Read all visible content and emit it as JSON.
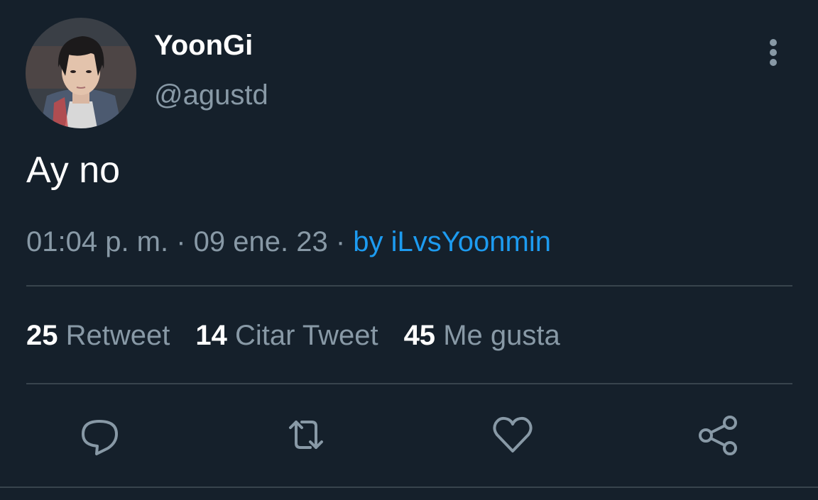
{
  "tweet": {
    "display_name": "YoonGi",
    "handle": "@agustd",
    "text": "Ay no",
    "time": "01:04 p. m.",
    "separator_1": " · ",
    "date": "09 ene. 23",
    "separator_2": " · ",
    "source": "by iLvsYoonmin"
  },
  "stats": [
    {
      "count": "25",
      "label": "Retweet"
    },
    {
      "count": "14",
      "label": "Citar Tweet"
    },
    {
      "count": "45",
      "label": "Me gusta"
    }
  ],
  "actions": [
    {
      "icon": "reply-icon"
    },
    {
      "icon": "retweet-icon"
    },
    {
      "icon": "like-icon"
    },
    {
      "icon": "share-icon"
    }
  ],
  "theme": {
    "background": "#15202b",
    "primary_text": "#ffffff",
    "secondary_text": "#8899a6",
    "link": "#1d9bf0",
    "divider": "#38444d"
  }
}
